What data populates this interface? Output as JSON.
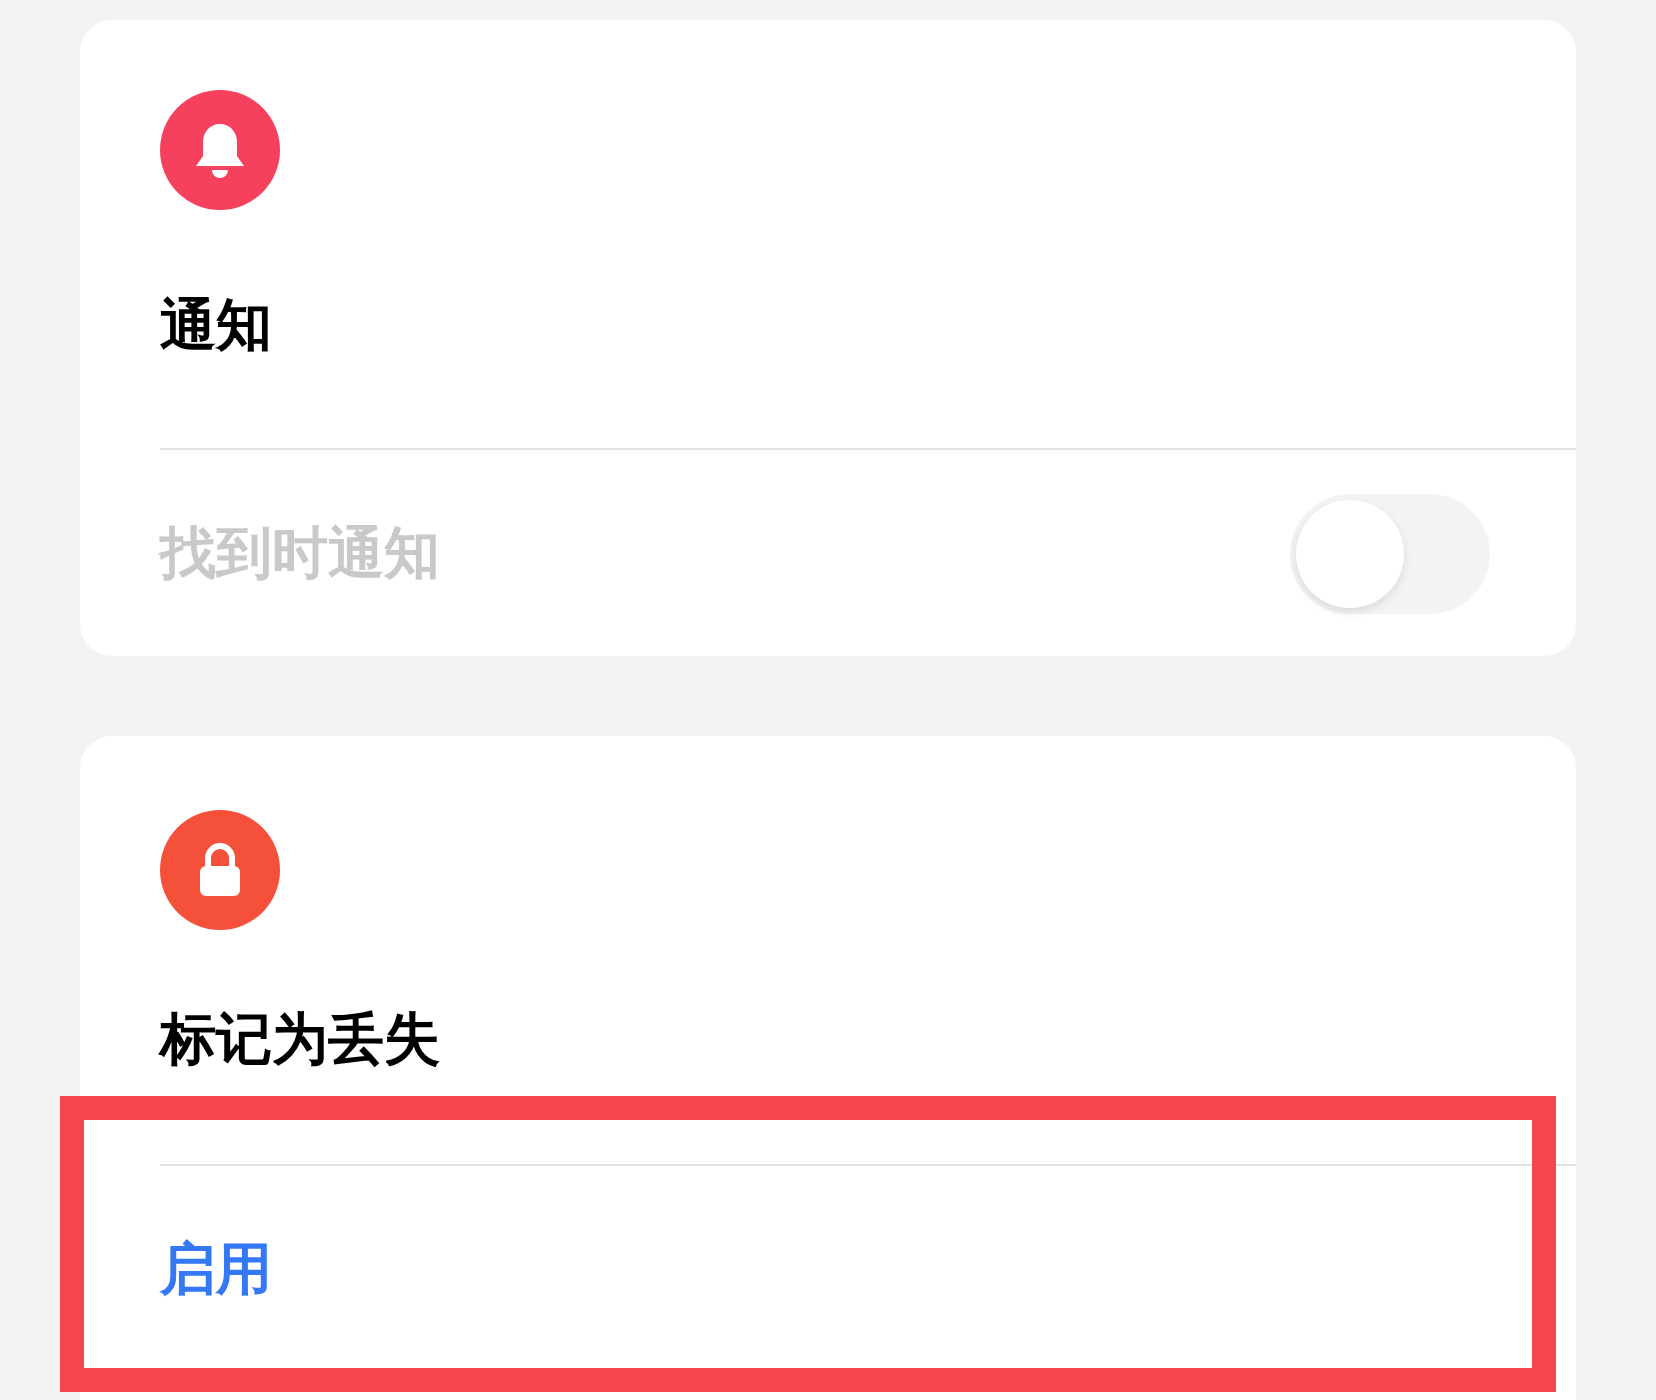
{
  "cards": [
    {
      "title": "通知",
      "row": {
        "kind": "toggle",
        "label": "找到时通知",
        "on": false,
        "disabled": true
      },
      "highlighted": false
    },
    {
      "title": "标记为丢失",
      "row": {
        "kind": "action",
        "label": "启用"
      },
      "highlighted": true
    }
  ]
}
